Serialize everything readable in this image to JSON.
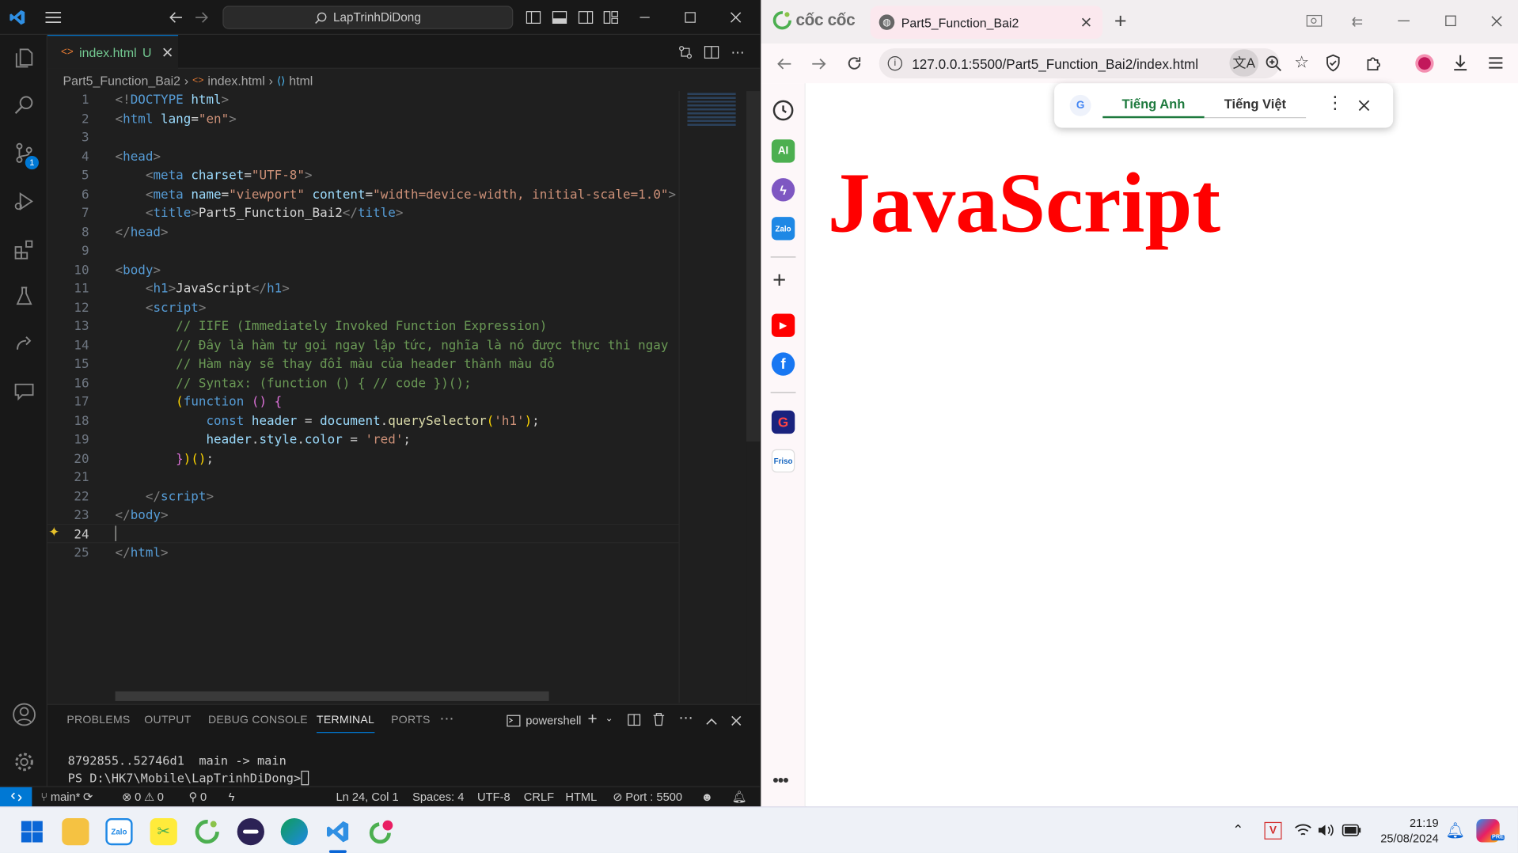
{
  "vscode": {
    "search": "LapTrinhDiDong",
    "tab_label": "index.html",
    "tab_status": "U",
    "breadcrumb": [
      "Part5_Function_Bai2",
      "index.html",
      "html"
    ],
    "line_numbers": [
      "1",
      "2",
      "3",
      "4",
      "5",
      "6",
      "7",
      "8",
      "9",
      "10",
      "11",
      "12",
      "13",
      "14",
      "15",
      "16",
      "17",
      "18",
      "19",
      "20",
      "21",
      "22",
      "23",
      "24",
      "25"
    ],
    "source_control_badge": "1",
    "panel_tabs": [
      "PROBLEMS",
      "OUTPUT",
      "DEBUG CONSOLE",
      "TERMINAL",
      "PORTS"
    ],
    "terminal_shell": "powershell",
    "terminal_lines": [
      "8792855..52746d1  main -> main",
      "PS D:\\HK7\\Mobile\\LapTrinhDiDong> "
    ],
    "status": {
      "branch": "main*",
      "errors": "0",
      "warnings": "0",
      "ports": "0",
      "position": "Ln 24, Col 1",
      "spaces": "Spaces: 4",
      "encoding": "UTF-8",
      "eol": "CRLF",
      "language": "HTML",
      "port": "Port : 5500"
    }
  },
  "browser": {
    "brand": "cốc cốc",
    "tab_title": "Part5_Function_Bai2",
    "url": "127.0.0.1:5500/Part5_Function_Bai2/index.html",
    "translate_tabs": [
      "Tiếng Anh",
      "Tiếng Việt"
    ],
    "page_heading": "JavaScript",
    "heading_color": "#ff0000",
    "sidebar_ai": "AI",
    "sidebar_zalo": "Zalo",
    "sidebar_friso": "Friso"
  },
  "taskbar": {
    "time": "21:19",
    "date": "25/08/2024",
    "zalo": "Zalo",
    "pre": "PRE",
    "tray_v": "V"
  }
}
